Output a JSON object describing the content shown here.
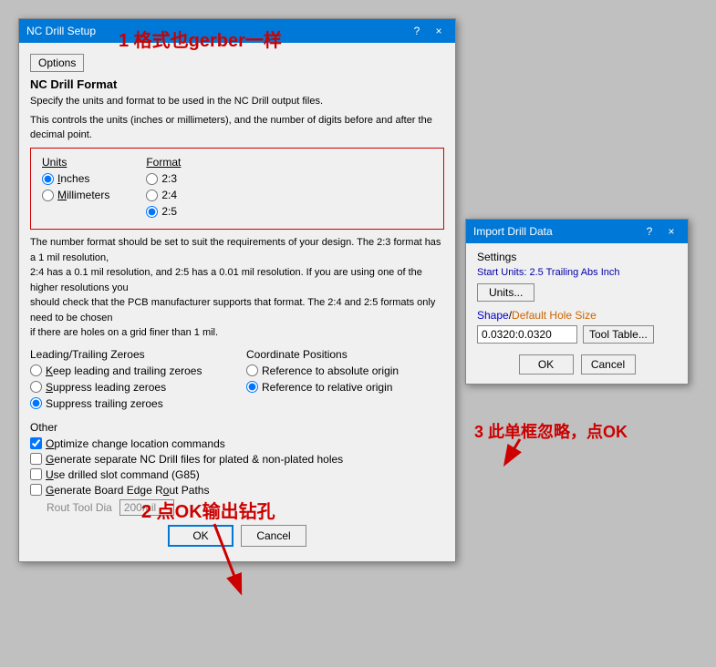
{
  "ncDrillDialog": {
    "title": "NC Drill Setup",
    "helpBtn": "?",
    "closeBtn": "×",
    "menuBar": {
      "optionsLabel": "Options"
    },
    "sectionTitle": "NC Drill Format",
    "desc1": "Specify the units and format to be used in the NC Drill output files.",
    "desc2": "This controls the units (inches or millimeters), and the number of digits before and after the decimal point.",
    "units": {
      "label": "Units",
      "options": [
        {
          "id": "inches",
          "label": "Inches",
          "checked": true
        },
        {
          "id": "millimeters",
          "label": "Millimeters",
          "checked": false
        }
      ]
    },
    "format": {
      "label": "Format",
      "options": [
        {
          "id": "f23",
          "label": "2:3",
          "checked": false
        },
        {
          "id": "f24",
          "label": "2:4",
          "checked": false
        },
        {
          "id": "f25",
          "label": "2:5",
          "checked": true
        }
      ]
    },
    "desc3": "The number format should be set to suit the requirements of your design. The 2:3 format has a 1 mil resolution,\n2:4 has a 0.1 mil resolution, and 2:5 has a 0.01 mil resolution. If you are using one of the higher resolutions you\nshould check that the PCB manufacturer supports that format. The 2:4 and 2:5 formats only need to be chosen\nif there are holes on a grid finer than 1 mil.",
    "leadingTrailing": {
      "label": "Leading/Trailing Zeroes",
      "options": [
        {
          "id": "lt1",
          "label": "Keep leading and trailing zeroes",
          "checked": false
        },
        {
          "id": "lt2",
          "label": "Suppress leading zeroes",
          "checked": false
        },
        {
          "id": "lt3",
          "label": "Suppress trailing zeroes",
          "checked": true
        }
      ]
    },
    "coordinatePositions": {
      "label": "Coordinate Positions",
      "options": [
        {
          "id": "cp1",
          "label": "Reference to absolute origin",
          "checked": false
        },
        {
          "id": "cp2",
          "label": "Reference to relative origin",
          "checked": true
        }
      ]
    },
    "other": {
      "label": "Other",
      "checkboxes": [
        {
          "id": "cb1",
          "label": "Optimize change location commands",
          "checked": true
        },
        {
          "id": "cb2",
          "label": "Generate separate NC Drill files for plated & non-plated holes",
          "checked": false
        },
        {
          "id": "cb3",
          "label": "Use drilled slot command (G85)",
          "checked": false
        },
        {
          "id": "cb4",
          "label": "Generate Board Edge Rout Paths",
          "checked": false
        }
      ],
      "routToolDia": {
        "label": "Rout Tool Dia",
        "value": "200mil"
      }
    },
    "buttons": {
      "ok": "OK",
      "cancel": "Cancel"
    }
  },
  "importDialog": {
    "title": "Import Drill Data",
    "helpBtn": "?",
    "closeBtn": "×",
    "settings": {
      "label": "Settings",
      "startUnitsLabel": "Start Units: 2.5 Trailing Abs Inch",
      "unitsBtn": "Units..."
    },
    "holeSize": {
      "label": "Shape/Default Hole Size",
      "value": "0.0320:0.0320",
      "toolTableBtn": "Tool Table..."
    },
    "buttons": {
      "ok": "OK",
      "cancel": "Cancel"
    }
  },
  "annotations": {
    "annot1": "1 格式也gerber一样",
    "annot2": "2 点OK输出钻孔",
    "annot3": "3 此单框忽略，点OK"
  }
}
